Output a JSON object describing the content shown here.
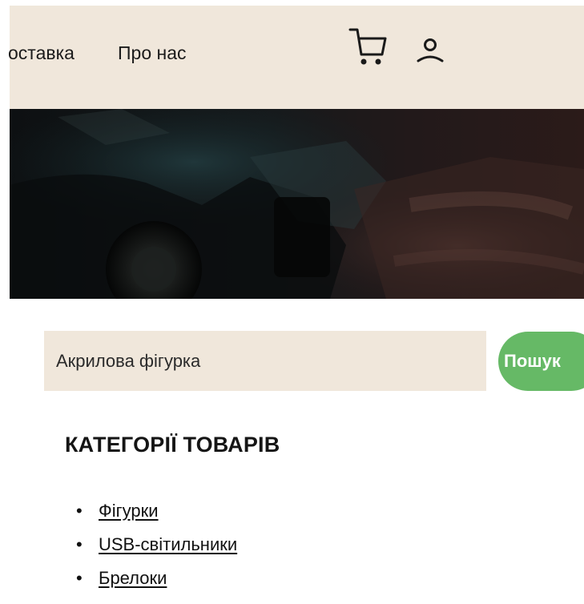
{
  "header": {
    "nav": [
      {
        "label": "оставка"
      },
      {
        "label": "Про нас"
      }
    ],
    "icons": [
      "cart-icon",
      "user-icon"
    ]
  },
  "hero": {
    "image": "dark-product-photo"
  },
  "search": {
    "value": "Акрилова фігурка",
    "button_label": "Пошук"
  },
  "categories": {
    "title": "КАТЕГОРІЇ ТОВАРІВ",
    "items": [
      {
        "label": "Фігурки"
      },
      {
        "label": "USB-світильники"
      },
      {
        "label": "Брелоки"
      }
    ]
  },
  "colors": {
    "header_bg": "#f0e7db",
    "search_bg": "#f0e7db",
    "button_bg": "#66b966",
    "button_text": "#ffffff",
    "text": "#111111"
  }
}
